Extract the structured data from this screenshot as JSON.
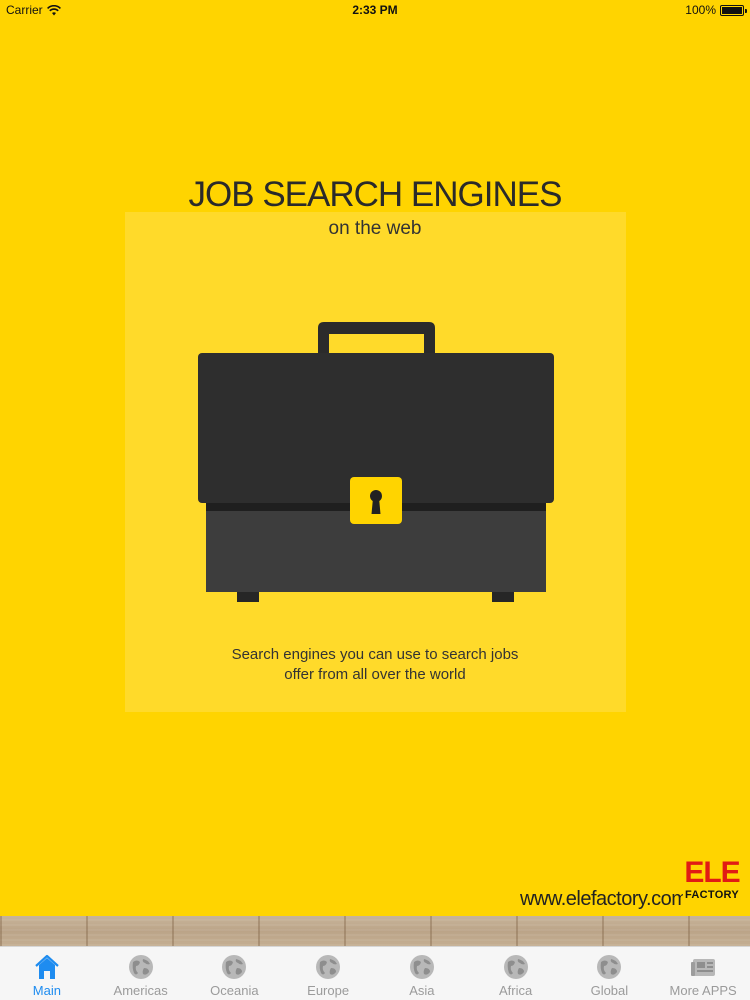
{
  "status_bar": {
    "carrier": "Carrier",
    "time": "2:33 PM",
    "battery": "100%",
    "battery_level": 1.0
  },
  "main": {
    "title": "JOB SEARCH ENGINES",
    "subtitle": "on the web",
    "description_line1": "Search engines you can use to search jobs",
    "description_line2": "offer from all over the world",
    "website": "www.elefactory.com",
    "logo_top": "ELE",
    "logo_bottom": "FACTORY"
  },
  "tabs": [
    {
      "label": "Main",
      "icon": "home-icon",
      "active": true
    },
    {
      "label": "Americas",
      "icon": "globe-icon",
      "active": false
    },
    {
      "label": "Oceania",
      "icon": "globe-icon",
      "active": false
    },
    {
      "label": "Europe",
      "icon": "globe-icon",
      "active": false
    },
    {
      "label": "Asia",
      "icon": "globe-icon",
      "active": false
    },
    {
      "label": "Africa",
      "icon": "globe-icon",
      "active": false
    },
    {
      "label": "Global",
      "icon": "globe-icon",
      "active": false
    },
    {
      "label": "More APPS",
      "icon": "newspaper-icon",
      "active": false
    }
  ],
  "colors": {
    "background": "#FFD400",
    "panel": "#FFDA2A",
    "briefcase_dark": "#2E2E2E",
    "briefcase_light": "#3A3A3A",
    "tab_active": "#1E8CF0",
    "tab_inactive": "#9B9B9B",
    "logo_red": "#E11B14"
  }
}
